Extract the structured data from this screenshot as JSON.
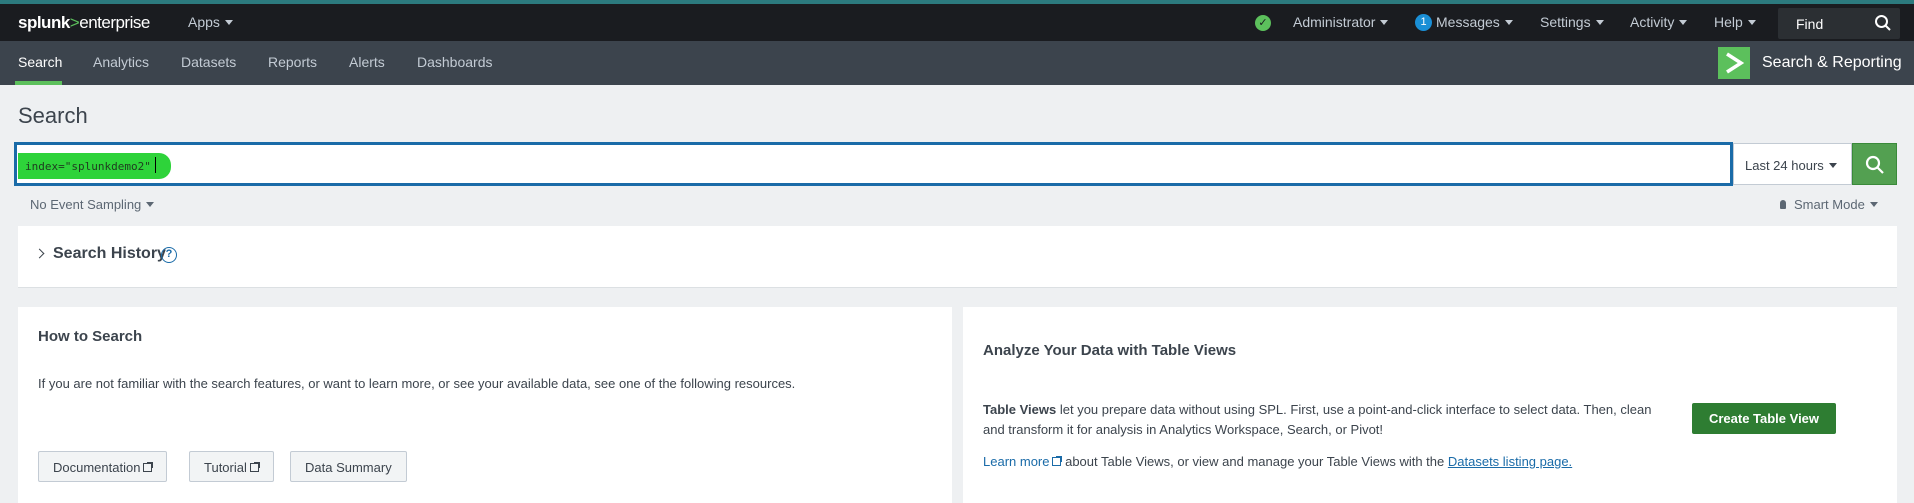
{
  "topbar": {
    "logo_brand": "splunk",
    "logo_gt": ">",
    "logo_product": "enterprise",
    "apps_label": "Apps",
    "user_label": "Administrator",
    "messages_count": "1",
    "messages_label": "Messages",
    "settings_label": "Settings",
    "activity_label": "Activity",
    "help_label": "Help",
    "find_label": "Find"
  },
  "appbar": {
    "tabs": [
      {
        "label": "Search",
        "active": true
      },
      {
        "label": "Analytics"
      },
      {
        "label": "Datasets"
      },
      {
        "label": "Reports"
      },
      {
        "label": "Alerts"
      },
      {
        "label": "Dashboards"
      }
    ],
    "app_name": "Search & Reporting"
  },
  "page": {
    "title": "Search",
    "query": "index=\"splunkdemo2\"",
    "time_range": "Last 24 hours",
    "sampling": "No Event Sampling",
    "mode": "Smart Mode"
  },
  "history": {
    "label": "Search History",
    "help_glyph": "?"
  },
  "how_to": {
    "title": "How to Search",
    "text": "If you are not familiar with the search features, or want to learn more, or see your available data, see one of the following resources.",
    "buttons": [
      "Documentation",
      "Tutorial",
      "Data Summary"
    ]
  },
  "table_views": {
    "title": "Analyze Your Data with Table Views",
    "bold_lead": "Table Views",
    "text_rest": " let you prepare data without using SPL. First, use a point-and-click interface to select data. Then, clean and transform it for analysis in Analytics Workspace, Search, or Pivot!",
    "learn_more": "Learn more",
    "learn_rest": " about Table Views, or view and manage your Table Views with the ",
    "datasets_link": "Datasets listing page.",
    "create_button": "Create Table View"
  },
  "colors": {
    "accent_green": "#5cc05c",
    "link_blue": "#1a6ba8",
    "query_highlight": "#2ed33a"
  }
}
